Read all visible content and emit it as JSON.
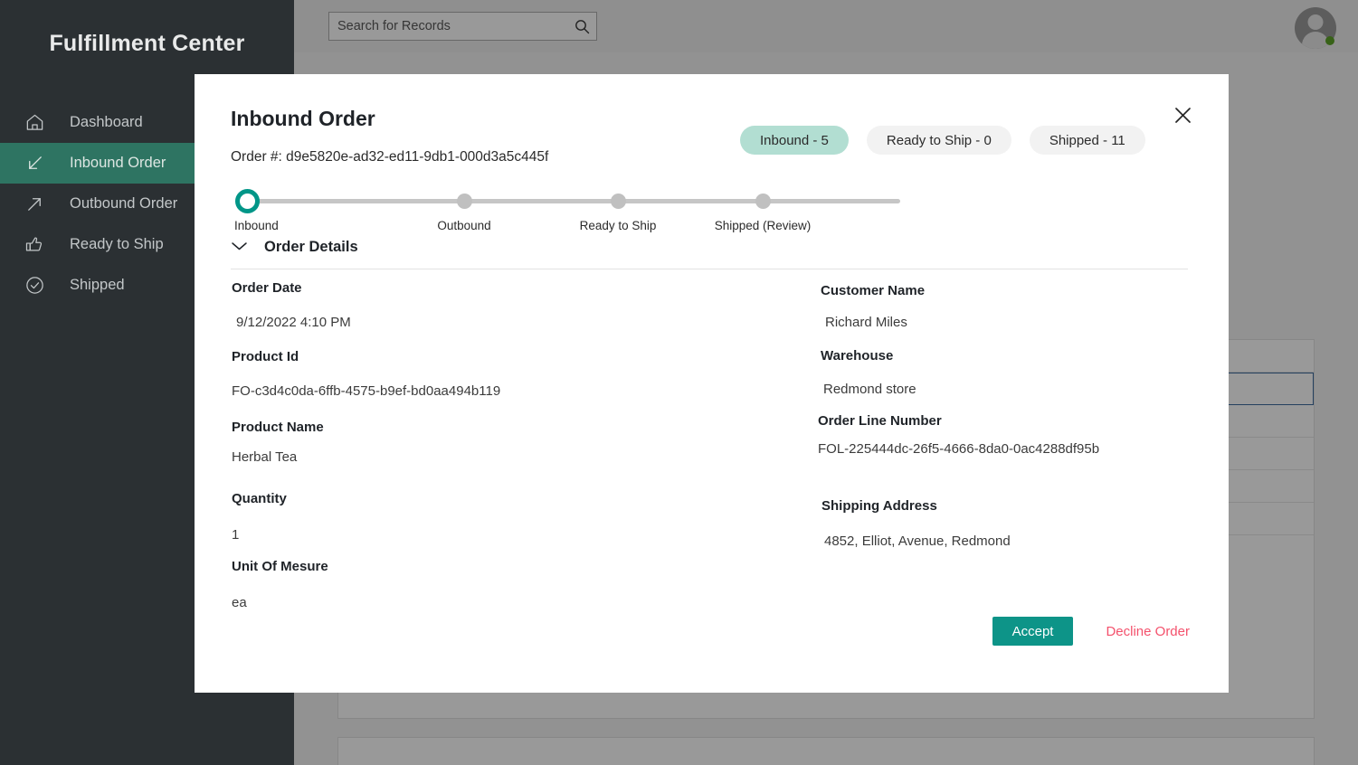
{
  "app": {
    "brand": "Fulfillment Center"
  },
  "topbar": {
    "search_placeholder": "Search for Records",
    "search_value": "",
    "search_icon": "search-icon",
    "avatar_icon": "avatar-icon",
    "status_dot_color": "#5EA328"
  },
  "sidebar": {
    "background": "#2B3033",
    "active_background": "#2E7462",
    "items": [
      {
        "label": "Dashboard",
        "icon": "home-icon",
        "active": false
      },
      {
        "label": "Inbound Order",
        "icon": "arrow-down-left-icon",
        "active": true
      },
      {
        "label": "Outbound Order",
        "icon": "arrow-up-right-icon",
        "active": false
      },
      {
        "label": "Ready to Ship",
        "icon": "thumbs-up-icon",
        "active": false
      },
      {
        "label": "Shipped",
        "icon": "check-circle-icon",
        "active": false
      }
    ]
  },
  "modal": {
    "title": "Inbound Order",
    "order_number_label": "Order #: d9e5820e-ad32-ed11-9db1-000d3a5c445f",
    "close_icon": "close-icon",
    "pills": [
      {
        "label": "Inbound - 5",
        "active": true
      },
      {
        "label": "Ready to Ship - 0",
        "active": false
      },
      {
        "label": "Shipped - 11",
        "active": false
      }
    ],
    "stepper": {
      "steps": [
        {
          "label": "Inbound",
          "current": true
        },
        {
          "label": "Outbound",
          "current": false
        },
        {
          "label": "Ready to Ship",
          "current": false
        },
        {
          "label": "Shipped (Review)",
          "current": false
        }
      ],
      "active_color": "#009688",
      "inactive_color": "#C0C0C0"
    },
    "section": {
      "title": "Order Details",
      "chevron_icon": "chevron-down-icon",
      "expanded": true
    },
    "fields_left": [
      {
        "label": "Order Date",
        "value": "9/12/2022 4:10 PM"
      },
      {
        "label": "Product Id",
        "value": "FO-c3d4c0da-6ffb-4575-b9ef-bd0aa494b119"
      },
      {
        "label": "Product Name",
        "value": "Herbal Tea"
      },
      {
        "label": "Quantity",
        "value": "1"
      },
      {
        "label": "Unit Of Mesure",
        "value": "ea"
      }
    ],
    "fields_right": [
      {
        "label": "Customer Name",
        "value": "Richard Miles"
      },
      {
        "label": "Warehouse",
        "value": "Redmond store"
      },
      {
        "label": "Order Line Number",
        "value": "FOL-225444dc-26f5-4666-8da0-0ac4288df95b"
      },
      {
        "label": "Shipping Address",
        "value": "4852, Elliot, Avenue, Redmond"
      }
    ],
    "actions": {
      "accept_label": "Accept",
      "accept_color": "#0D9488",
      "decline_label": "Decline Order",
      "decline_color": "#F4516C"
    }
  }
}
